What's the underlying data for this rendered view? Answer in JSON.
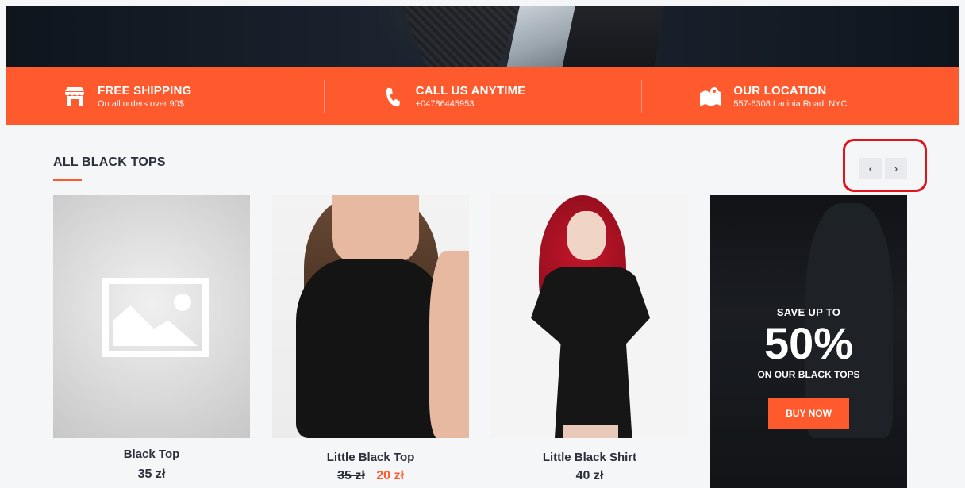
{
  "info_bar": [
    {
      "icon": "store-icon",
      "title": "FREE SHIPPING",
      "subtitle": "On all orders over 90$"
    },
    {
      "icon": "phone-icon",
      "title": "CALL US ANYTIME",
      "subtitle": "+04786445953"
    },
    {
      "icon": "map-pin-icon",
      "title": "OUR LOCATION",
      "subtitle": "557-6308 Lacinia Road. NYC"
    }
  ],
  "section": {
    "title": "ALL BLACK TOPS",
    "prev_label": "‹",
    "next_label": "›"
  },
  "products": [
    {
      "name": "Black Top",
      "price": "35 zł"
    },
    {
      "name": "Little Black Top",
      "old_price": "35 zł",
      "price": "20 zł"
    },
    {
      "name": "Little Black Shirt",
      "price": "40 zł"
    }
  ],
  "promo": {
    "line1": "SAVE UP TO",
    "headline": "50%",
    "line2": "ON OUR BLACK TOPS",
    "button": "BUY NOW"
  },
  "colors": {
    "accent": "#ff5a2e",
    "highlight_border": "#e0141c"
  }
}
